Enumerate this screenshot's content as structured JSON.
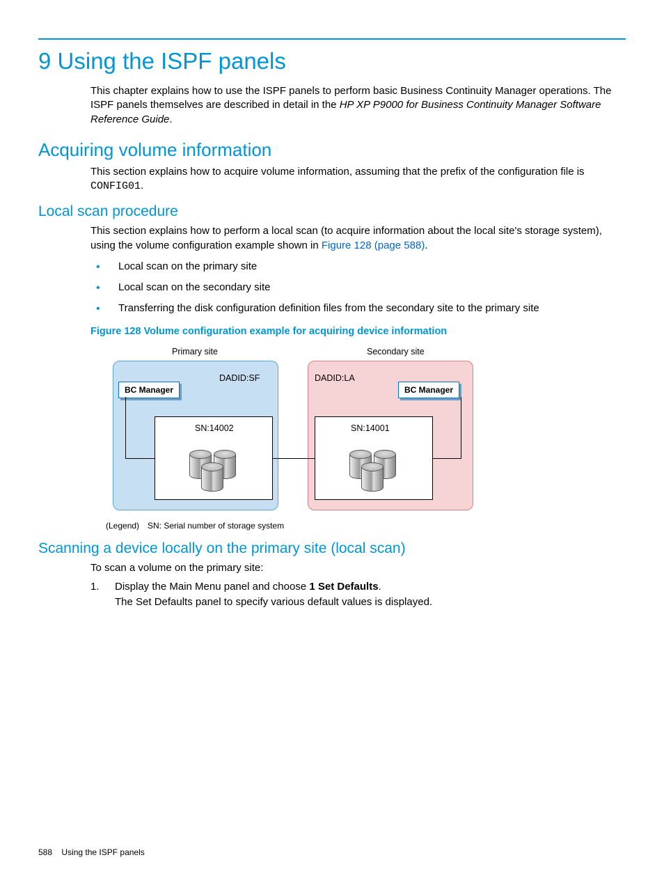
{
  "chapter": {
    "number": "9",
    "title": "Using the ISPF panels",
    "intro_pre": "This chapter explains how to use the ISPF panels to perform basic Business Continuity Manager operations. The ISPF panels themselves are described in detail in the ",
    "intro_italic": "HP XP P9000 for Business Continuity Manager Software Reference Guide",
    "intro_post": "."
  },
  "section1": {
    "title": "Acquiring volume information",
    "body_pre": "This section explains how to acquire volume information, assuming that the prefix of the configuration file is ",
    "body_mono": "CONFIG01",
    "body_post": "."
  },
  "subsection1": {
    "title": "Local scan procedure",
    "body_pre": "This section explains how to perform a local scan (to acquire information about the local site's storage system), using the volume configuration example shown in ",
    "xref": "Figure 128 (page 588)",
    "body_post": ".",
    "bullets": [
      "Local scan on the primary site",
      "Local scan on the secondary site",
      "Transferring the disk configuration definition files from the secondary site to the primary site"
    ],
    "figure_caption": "Figure 128 Volume configuration example for acquiring device information",
    "diagram": {
      "primary_label": "Primary site",
      "secondary_label": "Secondary site",
      "bc_manager": "BC Manager",
      "dadid_primary": "DADID:SF",
      "dadid_secondary": "DADID:LA",
      "sn_primary": "SN:14002",
      "sn_secondary": "SN:14001",
      "legend_label": "(Legend)",
      "legend_text": "SN: Serial number of storage system"
    }
  },
  "subsection2": {
    "title": "Scanning a device locally on the primary site (local scan)",
    "intro": "To scan a volume on the primary site:",
    "steps": [
      {
        "num": "1.",
        "line1_pre": "Display the Main Menu panel and choose ",
        "line1_bold": "1 Set Defaults",
        "line1_post": ".",
        "line2": "The Set Defaults panel to specify various default values is displayed."
      }
    ]
  },
  "footer": {
    "page": "588",
    "title": "Using the ISPF panels"
  }
}
